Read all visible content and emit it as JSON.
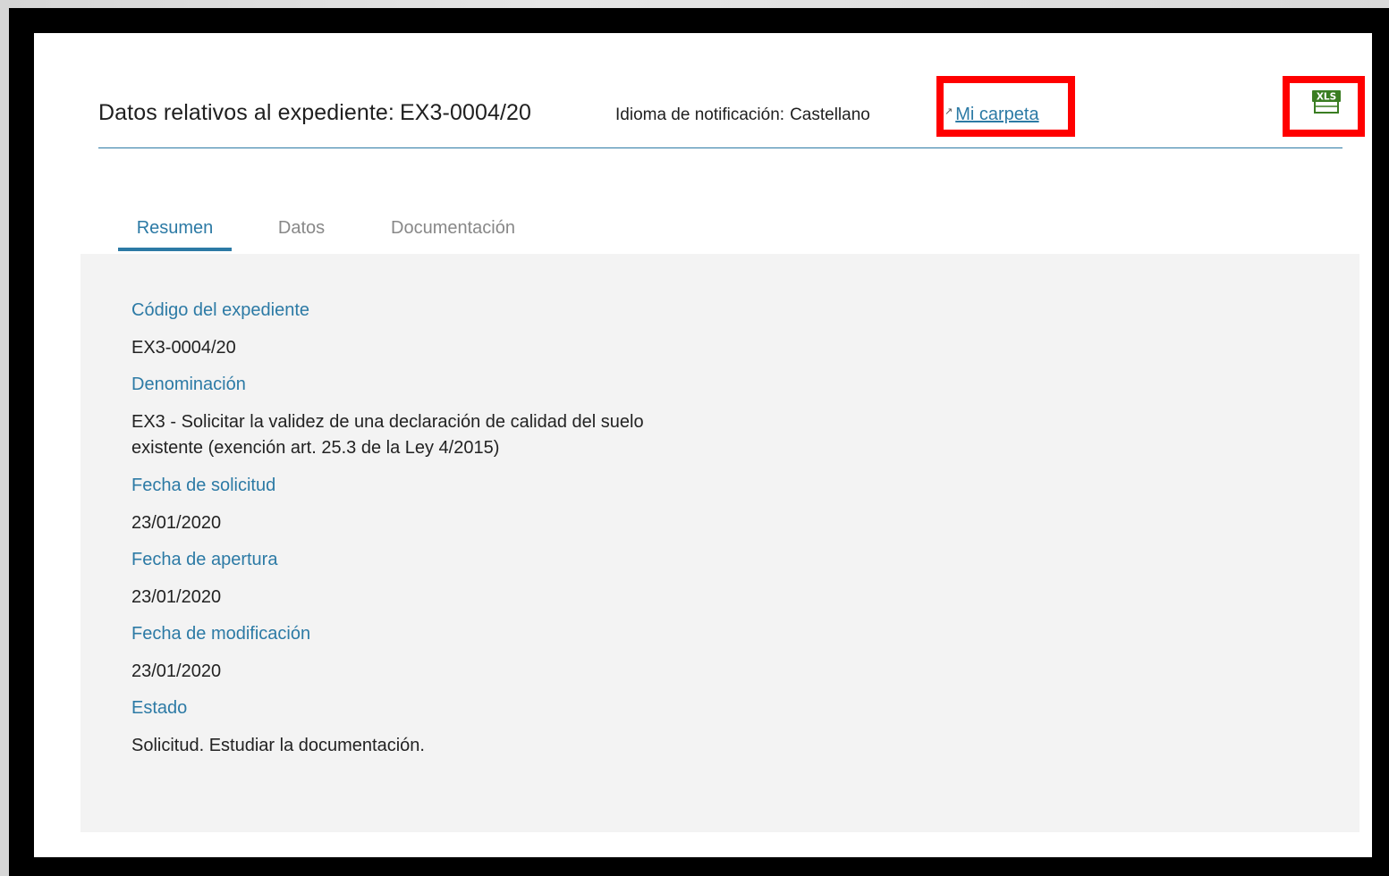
{
  "header": {
    "title": "Datos relativos al expediente:",
    "title_code": "EX3-0004/20",
    "language_label": "Idioma de notificación:",
    "language_value": "Castellano",
    "folder_link": "Mi carpeta",
    "export_icon": "xls-file-icon"
  },
  "tabs": [
    {
      "label": "Resumen",
      "active": true
    },
    {
      "label": "Datos",
      "active": false
    },
    {
      "label": "Documentación",
      "active": false
    }
  ],
  "summary": [
    {
      "label": "Código del expediente",
      "value": "EX3-0004/20"
    },
    {
      "label": "Denominación",
      "value": "EX3 - Solicitar la validez de una declaración de calidad del suelo existente (exención art. 25.3 de la Ley 4/2015)"
    },
    {
      "label": "Fecha de solicitud",
      "value": "23/01/2020"
    },
    {
      "label": "Fecha de apertura",
      "value": "23/01/2020"
    },
    {
      "label": "Fecha de modificación",
      "value": "23/01/2020"
    },
    {
      "label": "Estado",
      "value": "Solicitud. Estudiar la documentación."
    }
  ],
  "colors": {
    "accent": "#2c7aa5",
    "highlight": "#ff0000",
    "frame": "#000000",
    "content_bg": "#f3f3f3",
    "xls_green": "#3a7d22"
  }
}
